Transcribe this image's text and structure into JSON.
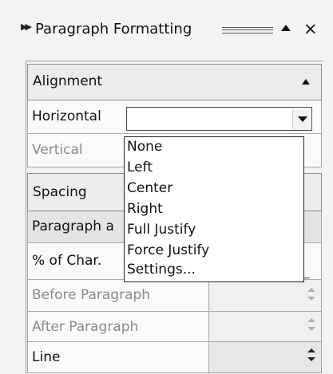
{
  "panel": {
    "title": "Paragraph Formatting",
    "grip_icon": "double-chevron-right-icon",
    "collapse_icon": "triangle-up-icon",
    "close_label": "×"
  },
  "alignment": {
    "header": "Alignment",
    "horizontal_label": "Horizontal",
    "horizontal_value": "",
    "vertical_label": "Vertical",
    "options": [
      "None",
      "Left",
      "Center",
      "Right",
      "Full Justify",
      "Force Justify",
      "Settings..."
    ]
  },
  "spacing": {
    "header": "Spacing",
    "rows": [
      {
        "label": "Paragraph a",
        "disabled": false
      },
      {
        "label": "% of Char.",
        "disabled": false
      },
      {
        "label": "Before Paragraph",
        "disabled": true
      },
      {
        "label": "After Paragraph",
        "disabled": true
      },
      {
        "label": "Line",
        "disabled": false
      }
    ]
  }
}
